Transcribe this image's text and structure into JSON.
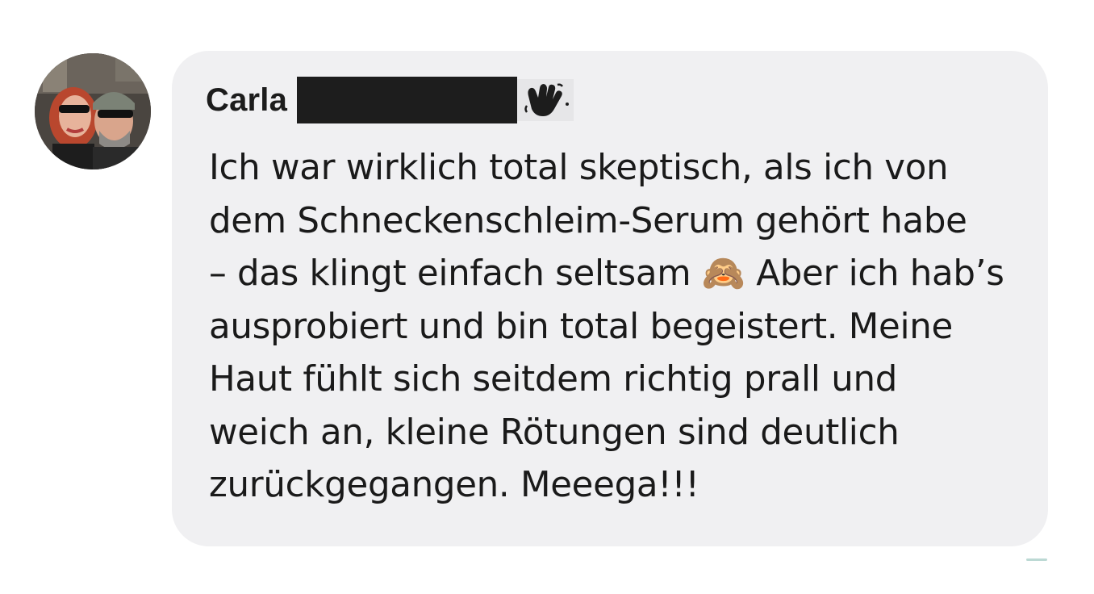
{
  "comment": {
    "author_name": "Carla",
    "author_badge_icon": "waving-hand-icon",
    "author_name_redacted": true,
    "avatar_icon": "profile-photo-avatar",
    "text": "Ich war wirklich total skeptisch, als ich von\ndem Schneckenschleim-Serum gehört habe\n– das klingt einfach seltsam 🙈 Aber ich hab’s\nausprobiert und bin total begeistert. Meine\nHaut fühlt sich seitdem richtig prall und\nweich an, kleine Rötungen sind deutlich\nzurückgegangen. Meeega!!!"
  },
  "colors": {
    "bubble_background": "#f0f0f2",
    "text": "#1a1a1a",
    "redaction": "#1d1d1d"
  }
}
